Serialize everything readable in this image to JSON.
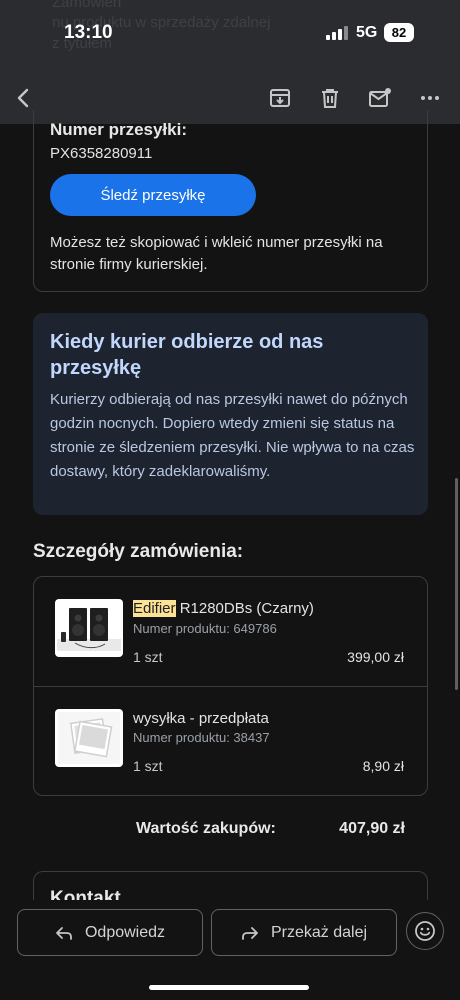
{
  "status_bar": {
    "time": "13:10",
    "network": "5G",
    "battery": "82",
    "scrolled_header_lines": [
      "Zamówien",
      "nu produktu w sprzedaży zdalnej",
      "z tytułem"
    ]
  },
  "toolbar": {
    "back_icon": "arrow-left-icon",
    "archive_icon": "archive-icon",
    "delete_icon": "trash-icon",
    "mark_unread_icon": "mail-unread-icon",
    "more_icon": "more-horizontal-icon"
  },
  "tracking": {
    "label": "Numer przesyłki:",
    "number": "PX6358280911",
    "button": "Śledź przesyłkę",
    "note": "Możesz też skopiować i wkleić numer przesyłki na stronie firmy kurierskiej."
  },
  "courier_info": {
    "title": "Kiedy kurier odbierze od nas przesyłkę",
    "body": "Kurierzy odbierają od nas przesyłki nawet do późnych godzin nocnych. Dopiero wtedy zmieni się status na stronie ze śledzeniem przesyłki. Nie wpływa to na czas dostawy, który zadeklarowaliśmy."
  },
  "order": {
    "heading": "Szczegóły zamówienia:",
    "items": [
      {
        "name_highlight": "Edifier",
        "name_rest": " R1280DBs (Czarny)",
        "product_number": "Numer produktu: 649786",
        "qty": "1 szt",
        "price": "399,00 zł"
      },
      {
        "name": "wysyłka - przedpłata",
        "product_number": "Numer produktu: 38437",
        "qty": "1 szt",
        "price": "8,90 zł"
      }
    ],
    "total_label": "Wartość zakupów:",
    "total_value": "407,90 zł"
  },
  "contact": {
    "title": "Kontakt"
  },
  "actions": {
    "reply": "Odpowiedz",
    "forward": "Przekaż dalej",
    "emoji_icon": "emoji-smile-icon"
  }
}
